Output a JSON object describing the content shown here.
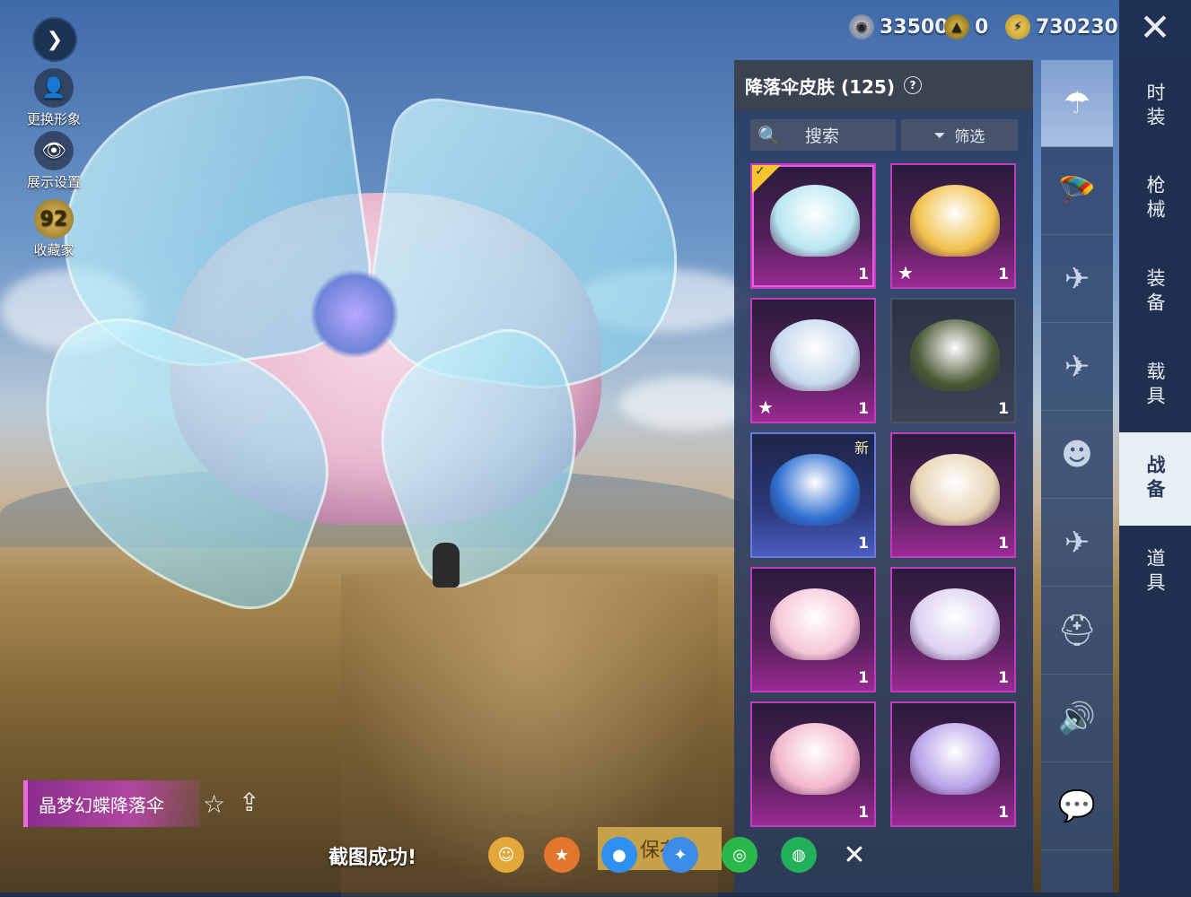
{
  "left_controls": {
    "change_avatar": "更换形象",
    "display_settings": "展示设置",
    "collector": "收藏家",
    "collector_level": "92"
  },
  "currency": {
    "silver": "33500",
    "gold_badge": "0",
    "coupons": "730230"
  },
  "panel": {
    "title": "降落伞皮肤 (125)",
    "help": "?",
    "search_label": "搜索",
    "filter_label": "筛选"
  },
  "cards": [
    {
      "qty": "1",
      "rarity": "purple",
      "selected": true
    },
    {
      "qty": "1",
      "rarity": "purple",
      "star": true
    },
    {
      "qty": "1",
      "rarity": "purple",
      "star": true
    },
    {
      "qty": "1",
      "rarity": "dark"
    },
    {
      "qty": "1",
      "rarity": "blue",
      "new": "新"
    },
    {
      "qty": "1",
      "rarity": "purple"
    },
    {
      "qty": "1",
      "rarity": "purple"
    },
    {
      "qty": "1",
      "rarity": "purple"
    },
    {
      "qty": "1",
      "rarity": "purple"
    },
    {
      "qty": "1",
      "rarity": "purple"
    }
  ],
  "categories": [
    "parachute-icon",
    "skydive-icon",
    "plane-trail-icon",
    "airplane-icon",
    "emote-icon",
    "glider-icon",
    "helmet-icon",
    "sound-icon",
    "chat-icon"
  ],
  "tabs": {
    "fashion": "时装",
    "weapons": "枪械",
    "equipment": "装备",
    "vehicles": "载具",
    "battle_gear": "战备",
    "items": "道具"
  },
  "item_name": "晶梦幻蝶降落伞",
  "toast": "截图成功!",
  "save_button": "保存",
  "colors": {
    "accent_purple": "#b0479f",
    "panel_bg": "#283a5f",
    "tab_active": "#e8eef6"
  }
}
